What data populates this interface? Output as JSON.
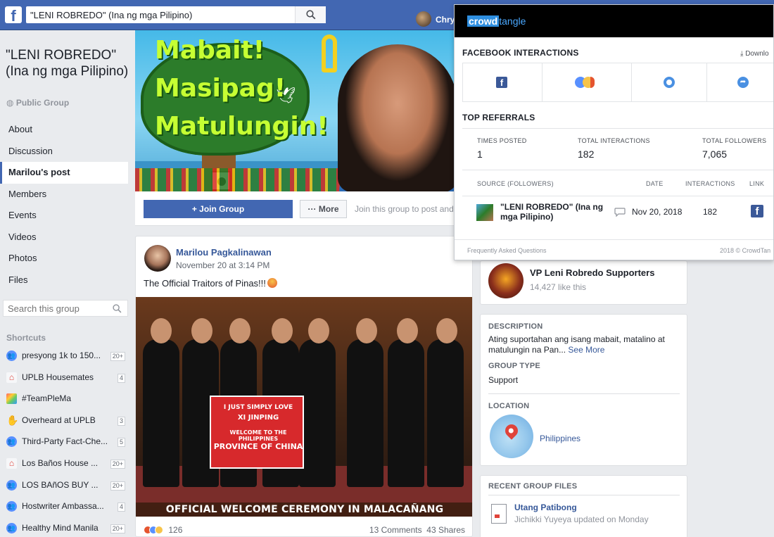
{
  "topbar": {
    "logo": "f",
    "search_value": "\"LENI ROBREDO\" (Ina ng mga Pilipino)",
    "user_name": "Chry"
  },
  "group": {
    "title": "\"LENI ROBREDO\" (Ina ng mga Pilipino)",
    "type": "Public Group",
    "nav": [
      "About",
      "Discussion",
      "Marilou's post",
      "Members",
      "Events",
      "Videos",
      "Photos",
      "Files"
    ],
    "active_nav": "Marilou's post",
    "search_placeholder": "Search this group"
  },
  "shortcuts": {
    "heading": "Shortcuts",
    "items": [
      {
        "label": "presyong 1k to 150...",
        "badge": "20+",
        "icon": "group-icon"
      },
      {
        "label": "UPLB Housemates",
        "badge": "4",
        "icon": "house-icon"
      },
      {
        "label": "#TeamPleMa",
        "badge": "",
        "icon": "rainbow-icon"
      },
      {
        "label": "Overheard at UPLB",
        "badge": "3",
        "icon": "hand-icon"
      },
      {
        "label": "Third-Party Fact-Che...",
        "badge": "5",
        "icon": "group-icon"
      },
      {
        "label": "Los Baños House ...",
        "badge": "20+",
        "icon": "house-icon"
      },
      {
        "label": "LOS BAñOS BUY ...",
        "badge": "20+",
        "icon": "group-icon"
      },
      {
        "label": "Hostwriter Ambassa...",
        "badge": "4",
        "icon": "group-icon"
      },
      {
        "label": "Healthy Mind Manila",
        "badge": "20+",
        "icon": "group-icon"
      }
    ]
  },
  "cover": {
    "lines": [
      "Mabait!",
      "Masipag!",
      "Matulungin!"
    ]
  },
  "joinbar": {
    "join_label": "+ Join Group",
    "more_label": "··· More",
    "prompt": "Join this group to post and c"
  },
  "post": {
    "author": "Marilou Pagkalinawan",
    "time": "November 20 at 3:14 PM",
    "text": "The Official Traitors of Pinas!!!",
    "banner_lines": [
      "I JUST SIMPLY LOVE",
      "XI JINPING",
      "WELCOME TO THE PHILIPPINES",
      "PROVINCE OF CHINA"
    ],
    "caption": "OFFICIAL WELCOME CEREMONY IN MALACAÑANG",
    "reaction_count": "126",
    "comments": "13 Comments",
    "shares": "43 Shares"
  },
  "related": {
    "name": "VP Leni Robredo Supporters",
    "likes": "14,427 like this"
  },
  "about": {
    "desc_head": "DESCRIPTION",
    "desc": "Ating suportahan ang isang mabait, matalino at matulungin na Pan...",
    "see_more": "See More",
    "type_head": "GROUP TYPE",
    "type": "Support",
    "loc_head": "LOCATION",
    "location": "Philippines"
  },
  "files": {
    "head": "RECENT GROUP FILES",
    "name": "Utang Patibong",
    "meta": "Jichikki Yuyeya updated on Monday"
  },
  "crowdtangle": {
    "logo_a": "crowd",
    "logo_b": "tangle",
    "interactions_head": "FACEBOOK INTERACTIONS",
    "download": "Downlo",
    "referrals_head": "TOP REFERRALS",
    "times_posted_head": "TIMES POSTED",
    "times_posted": "1",
    "total_interactions_head": "TOTAL INTERACTIONS",
    "total_interactions": "182",
    "total_followers_head": "TOTAL FOLLOWERS",
    "total_followers": "7,065",
    "col_source": "SOURCE (FOLLOWERS)",
    "col_date": "DATE",
    "col_interactions": "INTERACTIONS",
    "col_link": "LINK",
    "row_name": "\"LENI ROBREDO\" (Ina ng mga Pilipino)",
    "row_date": "Nov 20, 2018",
    "row_interactions": "182",
    "faq": "Frequently Asked Questions",
    "copyright": "2018 © CrowdTan"
  }
}
